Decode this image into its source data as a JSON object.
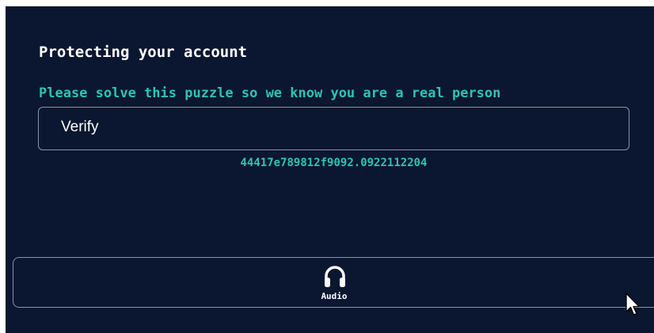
{
  "header": {
    "title": "Protecting your account",
    "subtitle": "Please solve this puzzle so we know you are a real person"
  },
  "verify": {
    "label": "Verify"
  },
  "session": {
    "code": "44417e789812f9092.0922112204"
  },
  "audio": {
    "label": "Audio",
    "icon": "headphones-icon"
  },
  "colors": {
    "background": "#0b1730",
    "accent": "#2cc5b4",
    "text": "#ffffff",
    "border": "#8a93a6"
  }
}
